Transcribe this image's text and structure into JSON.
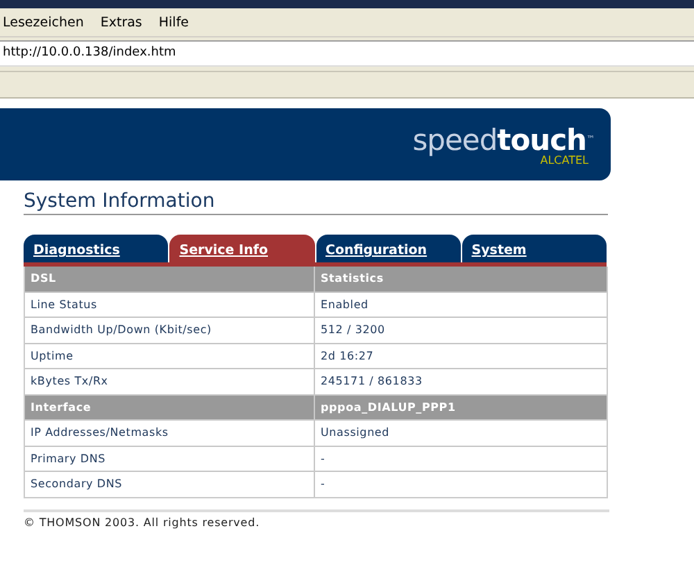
{
  "browser": {
    "menu": [
      "Lesezeichen",
      "Extras",
      "Hilfe"
    ],
    "address": "http://10.0.0.138/index.htm"
  },
  "banner": {
    "logo_light": "speed",
    "logo_bold": "touch",
    "trademark": "™",
    "maker": "ALCATEL"
  },
  "page_title": "System Information",
  "tabs": [
    {
      "label": "Diagnostics",
      "selected": false
    },
    {
      "label": "Service Info",
      "selected": true
    },
    {
      "label": "Configuration",
      "selected": false
    },
    {
      "label": "System",
      "selected": false
    }
  ],
  "table": {
    "rows": [
      {
        "kind": "header",
        "cells": [
          "DSL",
          "Statistics"
        ]
      },
      {
        "kind": "data",
        "cells": [
          "Line Status",
          "Enabled"
        ]
      },
      {
        "kind": "data",
        "cells": [
          "Bandwidth Up/Down (Kbit/sec)",
          "512 / 3200"
        ]
      },
      {
        "kind": "data",
        "cells": [
          "Uptime",
          "2d 16:27"
        ]
      },
      {
        "kind": "data",
        "cells": [
          "kBytes Tx/Rx",
          "245171 / 861833"
        ]
      },
      {
        "kind": "header",
        "cells": [
          "Interface",
          "pppoa_DIALUP_PPP1"
        ]
      },
      {
        "kind": "data",
        "cells": [
          "IP Addresses/Netmasks",
          "Unassigned"
        ]
      },
      {
        "kind": "data",
        "cells": [
          "Primary DNS",
          "-"
        ]
      },
      {
        "kind": "data",
        "cells": [
          "Secondary DNS",
          "-"
        ]
      }
    ]
  },
  "footer": "© THOMSON 2003. All rights reserved."
}
